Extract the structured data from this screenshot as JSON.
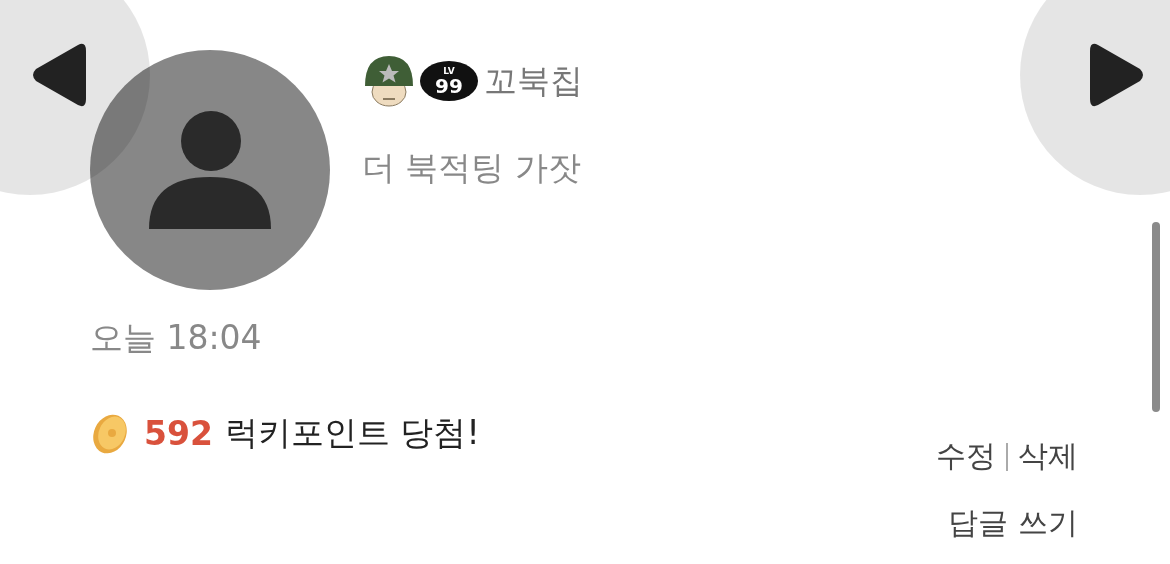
{
  "author": {
    "name": "꼬북칩",
    "level_badge": {
      "label": "LV",
      "value": "99"
    }
  },
  "status_message": "더 북적팅 가잣",
  "timestamp": "오늘 18:04",
  "reward": {
    "points": "592",
    "message": "럭키포인트 당첨!"
  },
  "edit_actions": [
    "수정",
    "삭제"
  ],
  "reply_button": "답글 쓰기"
}
